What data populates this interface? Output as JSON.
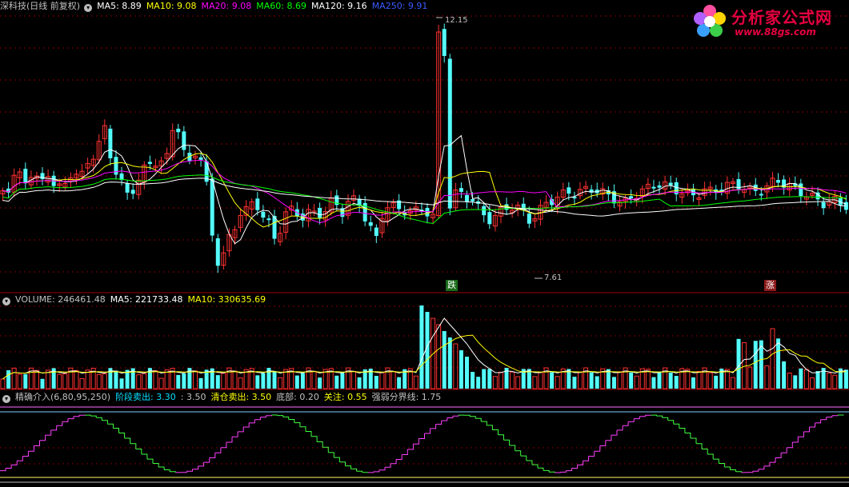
{
  "main_header": {
    "title": "深科技(日线 前复权)",
    "ma": [
      {
        "label": "MA5: 8.89",
        "color": "#ffffff"
      },
      {
        "label": "MA10: 9.08",
        "color": "#ffff00"
      },
      {
        "label": "MA20: 9.08",
        "color": "#ff00ff"
      },
      {
        "label": "MA60: 8.69",
        "color": "#00ff00"
      },
      {
        "label": "MA120: 9.16",
        "color": "#ffffff"
      },
      {
        "label": "MA250: 9.91",
        "color": "#3a5bff"
      }
    ]
  },
  "price_marks": {
    "high": "12.15",
    "low": "7.61"
  },
  "tags": {
    "fall": "跌",
    "rise": "涨"
  },
  "volume_header": {
    "title": "VOLUME: 246461.48",
    "ma5": "MA5: 221733.48",
    "ma10": "MA10: 330635.69"
  },
  "indicator_header": {
    "title": "精确介入(6,80,95,250)",
    "items": [
      {
        "label": "阶段卖出: 3.30",
        "color": "#00e0ff"
      },
      {
        "label": ": 3.50",
        "color": "#c0c0c0"
      },
      {
        "label": "清仓卖出: 3.50",
        "color": "#ffff00"
      },
      {
        "label": "底部: 0.20",
        "color": "#c0c0c0"
      },
      {
        "label": "关注: 0.55",
        "color": "#ffff00"
      },
      {
        "label": "强弱分界线: 1.75",
        "color": "#c0c0c0"
      }
    ]
  },
  "logo": {
    "title": "分析家公式网",
    "url": "www.88gs.com"
  },
  "colors": {
    "up": "#ff3232",
    "down": "#54fcfc",
    "grid": "#800000",
    "separator": "#a00000"
  }
}
